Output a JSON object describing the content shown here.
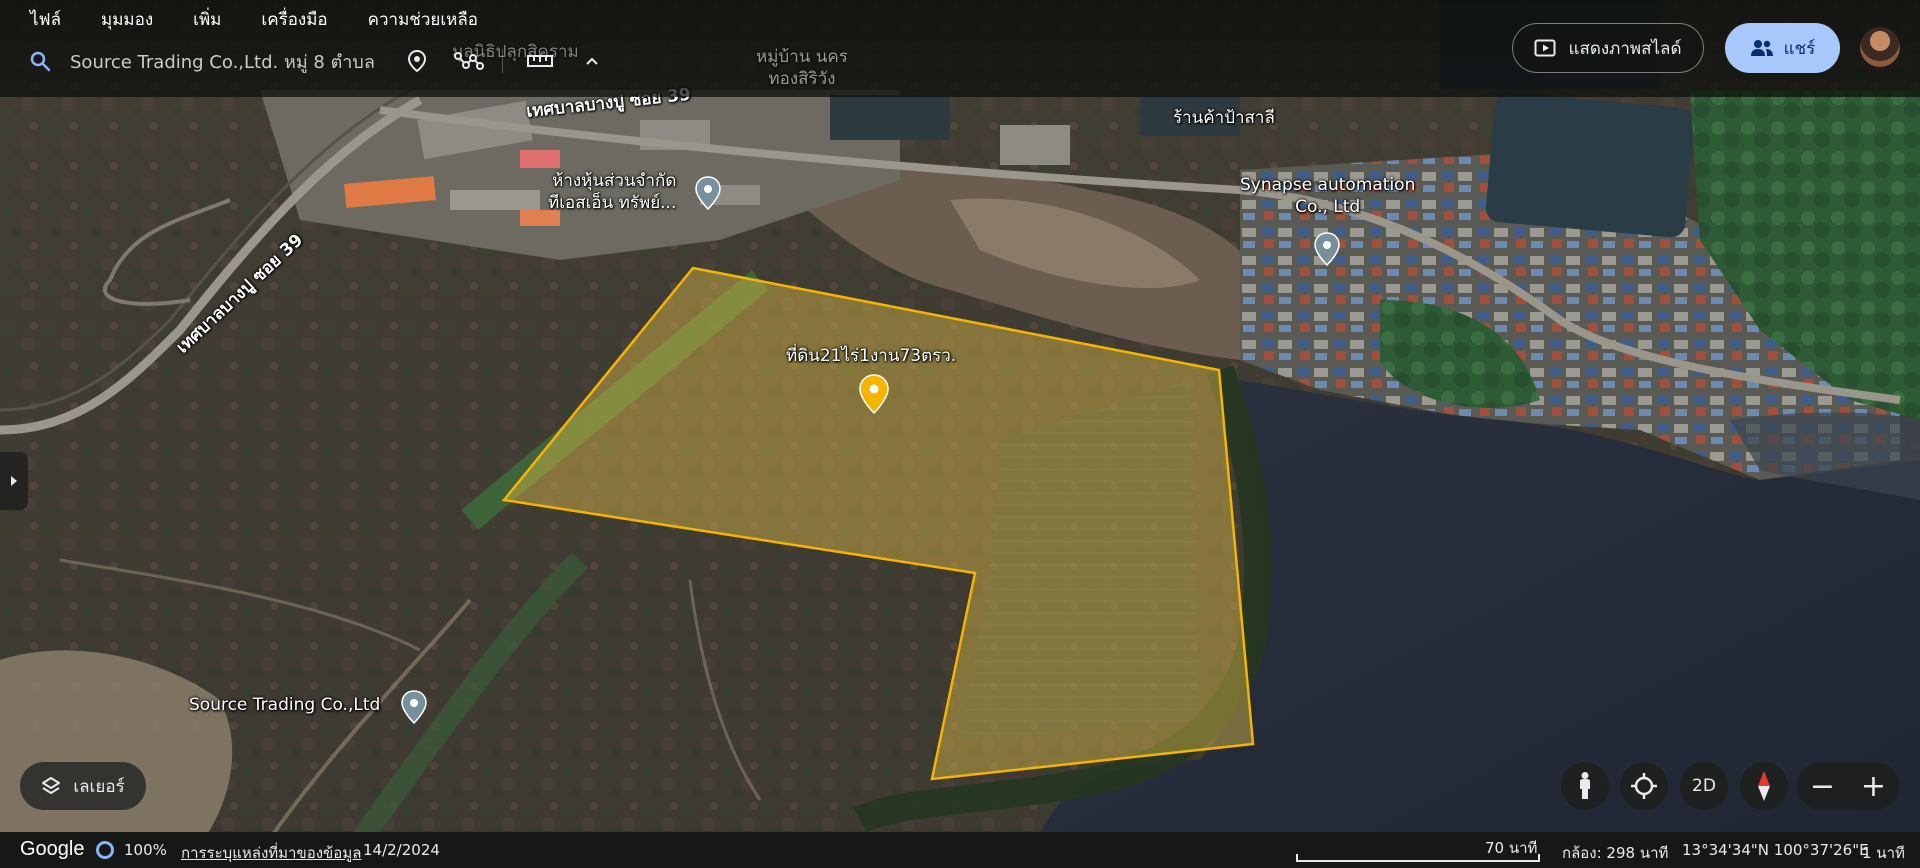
{
  "menu": {
    "items": [
      {
        "label": "ไฟล์"
      },
      {
        "label": "มุมมอง"
      },
      {
        "label": "เพิ่ม"
      },
      {
        "label": "เครื่องมือ"
      },
      {
        "label": "ความช่วยเหลือ"
      }
    ]
  },
  "search": {
    "value": "Source Trading Co.,Ltd. หมู่ 8 ตำบล",
    "icon": "search-icon"
  },
  "toolbar": {
    "icons": [
      "add-placemark-icon",
      "draw-path-icon",
      "measure-icon",
      "chevron-up-icon"
    ]
  },
  "header": {
    "slideshow_label": "แสดงภาพสไลด์",
    "share_label": "แชร์"
  },
  "map": {
    "polygon_label": "ที่ดิน21ไร่1งาน73ตรว.",
    "road_label_top": "เทศบาลบางปู ซอย 39",
    "road_label_left": "เทศบาลบางปู ซอย 39",
    "place_partnership_line1": "ห้างหุ้นส่วนจำกัด",
    "place_partnership_line2": "ทีเอสเอ็น ทรัพย์...",
    "place_shop": "ร้านค้าป้าสาลี",
    "place_synapse_line1": "Synapse automation",
    "place_synapse_line2": "Co., Ltd",
    "place_source": "Source Trading Co.,Ltd",
    "place_village_line1": "หมู่บ้าน นคร",
    "place_village_line2": "ทองสิริวัง",
    "place_temple": "มูลนิธิปลุกสิคราม",
    "colors": {
      "polygon_stroke": "#f4b400",
      "polygon_fill": "#e6c34a",
      "pin_yellow": "#f4b400",
      "pin_grey": "#78909c"
    }
  },
  "controls": {
    "layers_label": "เลเยอร์",
    "view_2d_label": "2D",
    "zoom_out": "−",
    "zoom_in": "+"
  },
  "status": {
    "logo": "Google",
    "load_percent": "100%",
    "data_attribution": "การระบุแหล่งที่มาของข้อมูล",
    "imagery_date": "14/2/2024",
    "scale_label": "70 นาที",
    "camera": "กล้อง: 298 นาที",
    "coordinates": "13°34'34\"N 100°37'26\"E",
    "elevation": "1 นาที"
  }
}
